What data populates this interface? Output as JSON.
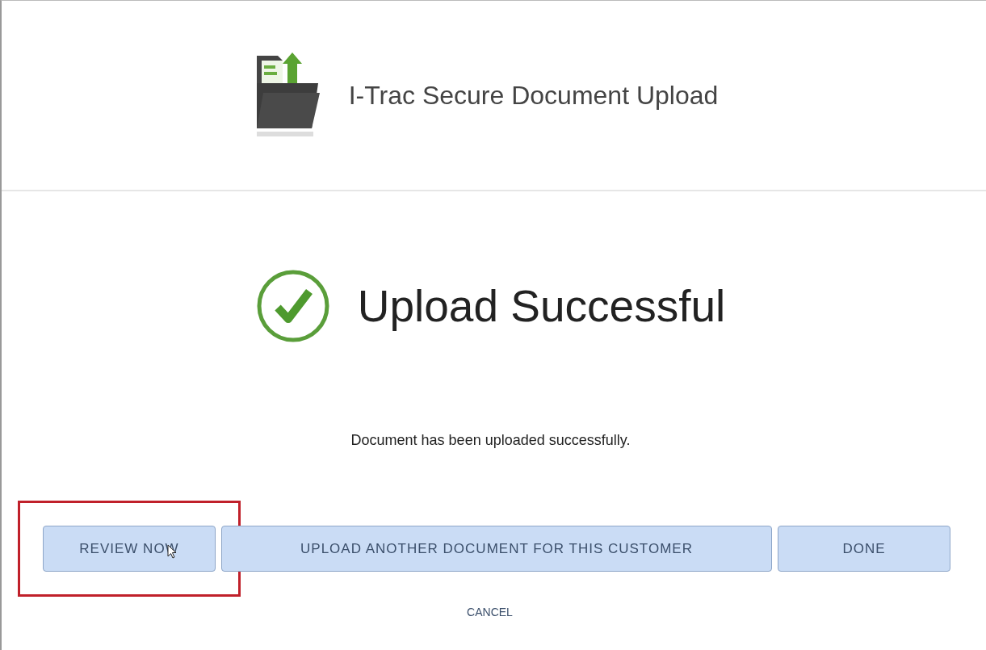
{
  "header": {
    "title": "I-Trac Secure Document Upload"
  },
  "status": {
    "kind": "success",
    "heading": "Upload Successful",
    "message": "Document has been uploaded successfully."
  },
  "buttons": [
    {
      "label": "REVIEW NOW",
      "highlighted": true,
      "hovered": true,
      "grow": false
    },
    {
      "label": "UPLOAD ANOTHER DOCUMENT FOR THIS CUSTOMER",
      "highlighted": false,
      "hovered": false,
      "grow": true
    },
    {
      "label": "DONE",
      "highlighted": false,
      "hovered": false,
      "grow": false
    }
  ],
  "cancel_link": "CANCEL"
}
